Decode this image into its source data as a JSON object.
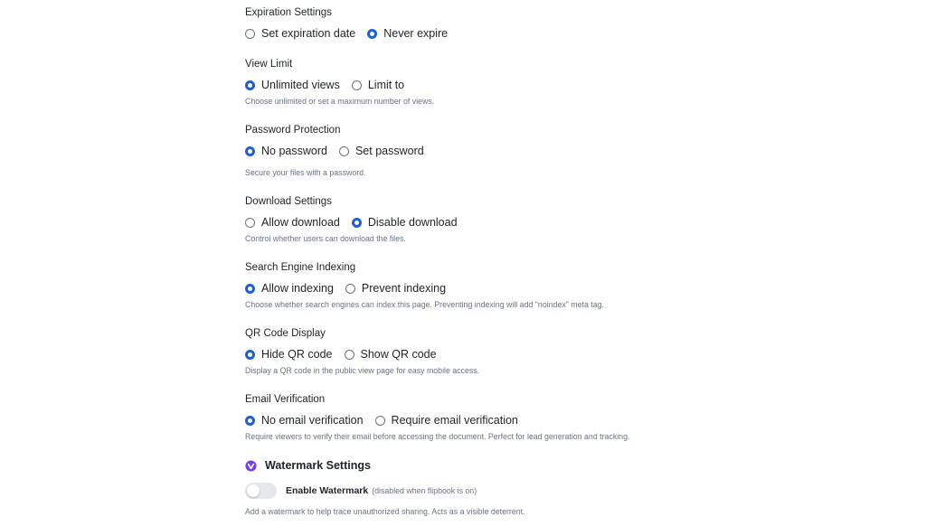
{
  "expiration": {
    "title": "Expiration Settings",
    "options": [
      {
        "label": "Set expiration date",
        "checked": false
      },
      {
        "label": "Never expire",
        "checked": true
      }
    ]
  },
  "view_limit": {
    "title": "View Limit",
    "options": [
      {
        "label": "Unlimited views",
        "checked": true
      },
      {
        "label": "Limit to",
        "checked": false
      }
    ],
    "help": "Choose unlimited or set a maximum number of views."
  },
  "password": {
    "title": "Password Protection",
    "options": [
      {
        "label": "No password",
        "checked": true
      },
      {
        "label": "Set password",
        "checked": false
      }
    ],
    "help": "Secure your files with a password."
  },
  "download": {
    "title": "Download Settings",
    "options": [
      {
        "label": "Allow download",
        "checked": false
      },
      {
        "label": "Disable download",
        "checked": true
      }
    ],
    "help": "Control whether users can download the files."
  },
  "indexing": {
    "title": "Search Engine Indexing",
    "options": [
      {
        "label": "Allow indexing",
        "checked": true
      },
      {
        "label": "Prevent indexing",
        "checked": false
      }
    ],
    "help": "Choose whether search engines can index this page. Preventing indexing will add \"noindex\" meta tag."
  },
  "qr": {
    "title": "QR Code Display",
    "options": [
      {
        "label": "Hide QR code",
        "checked": true
      },
      {
        "label": "Show QR code",
        "checked": false
      }
    ],
    "help": "Display a QR code in the public view page for easy mobile access."
  },
  "email": {
    "title": "Email Verification",
    "options": [
      {
        "label": "No email verification",
        "checked": true
      },
      {
        "label": "Require email verification",
        "checked": false
      }
    ],
    "help": "Require viewers to verify their email before accessing the document. Perfect for lead generation and tracking."
  },
  "watermark": {
    "title": "Watermark Settings",
    "icon": "watermark-icon",
    "toggle_label": "Enable Watermark",
    "toggle_note": "(disabled when flipbook is on)",
    "enabled": false,
    "help": "Add a watermark to help trace unauthorized sharing. Acts as a visible deterrent."
  },
  "colors": {
    "accent": "#1f5fd6",
    "watermark_icon": "#7c3aed",
    "toggle_off": "#e5e7eb"
  }
}
